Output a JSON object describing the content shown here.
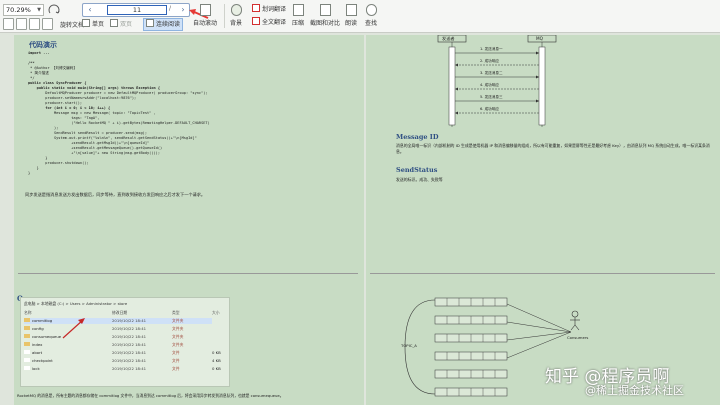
{
  "toolbar": {
    "zoom": "70.29%",
    "rotate_label": "旋转文档",
    "single_label": "单页",
    "double_label": "双页",
    "continuous_label": "连续阅读",
    "auto_scroll_label": "自动滚动",
    "page_input": "11",
    "page_total": "/",
    "background_label": "背景",
    "translate_label": "划词翻译",
    "full_translate_label": "全文翻译",
    "compress_label": "压缩",
    "screenshot_label": "截图和对比",
    "read_label": "朗读",
    "search_label": "查找"
  },
  "left_page": {
    "title": "代码演示",
    "code_lines": [
      "import ...",
      "",
      "/**",
      " * @Author 【刘博文编码】",
      " * 简介描述",
      " */",
      "public class SyncProducer {",
      "    public static void main(String[] args) throws Exception {",
      "        DefaultMQProducer producer = new DefaultMQProducer( producerGroup: \"sync\");",
      "        producer.setNamesrvAddr(\"localhost:9876\");",
      "        producer.start();",
      "        for (int i = 0; i < 10; i++) {",
      "            Message msg = new Message( topic: \"TopicTest\" ,",
      "                    tags: \"TagA\",",
      "                    (\"Hello RocketMQ \" + i).getBytes(RemotingHelper.DEFAULT_CHARSET)",
      "            );",
      "            SendResult sendResult = producer.send(msg);",
      "            System.out.printf(\"%s%n%n\", sendResult.getSendStatus()+\"\\n[MsgId]\"",
      "                    +sendResult.getMsgId()+\"\\n[queueId]\"",
      "                    +sendResult.getMessageQueue().getQueueId()",
      "                    +\"\\n[value]\"+ new String(msg.getBody()));",
      "        }",
      "        producer.shutdown();",
      "    }",
      "}"
    ],
    "paragraph": "同步发送是指消息发送方发出数据后，同步等待，直到收到接收方发回响应之后才发下一个请求。",
    "queue_title": "Queue",
    "breadcrumb": "此电脑 > 本地磁盘 (C:) > Users > Administrator > store",
    "columns": [
      "名称",
      "修改日期",
      "类型",
      "大小"
    ],
    "files": [
      {
        "name": "commitlog",
        "date": "2019/10/22 18:41",
        "type": "文件夹",
        "size": ""
      },
      {
        "name": "config",
        "date": "2019/10/22 18:41",
        "type": "文件夹",
        "size": ""
      },
      {
        "name": "consumequeue",
        "date": "2019/10/22 18:41",
        "type": "文件夹",
        "size": ""
      },
      {
        "name": "index",
        "date": "2019/10/22 18:41",
        "type": "文件夹",
        "size": ""
      },
      {
        "name": "abort",
        "date": "2019/10/22 18:41",
        "type": "文件",
        "size": "0 KB"
      },
      {
        "name": "checkpoint",
        "date": "2019/10/22 18:41",
        "type": "文件",
        "size": "4 KB"
      },
      {
        "name": "lock",
        "date": "2019/10/22 18:41",
        "type": "文件",
        "size": "0 KB"
      }
    ],
    "bottom_text": "RocketMQ 的消息是，所有主题的消息都存储在 commitlog 文件中，当消息到达 commitlog 后，将会采用异步转发到消息队列，也就是 consumequeue。"
  },
  "right_page": {
    "seq_left": "发送者",
    "seq_right": "MQ",
    "seq_msgs": [
      "1. 发送消息一",
      "2. 成功响应",
      "3. 发送消息二",
      "4. 成功响应",
      "5. 发送消息三",
      "6. 成功响应"
    ],
    "msgid_title": "Message ID",
    "msgid_text": "消息的全局唯一标识（内部机制的 ID 生成是使用机器 IP 和消息偏移量的组成，所以有可能重复，如果是幂等性还是最好考虑 Key），由消息队列 MQ 系统自动生成，唯一标识某条消息。",
    "sendstatus_title": "SendStatus",
    "sendstatus_text": "发送的标识。成功、失败等",
    "topic_label": "TOPIC_A",
    "consumer_label": "Consumers"
  },
  "watermark": {
    "line1": "知乎 @程序员啊",
    "line2": "@稀土掘金技术社区"
  }
}
